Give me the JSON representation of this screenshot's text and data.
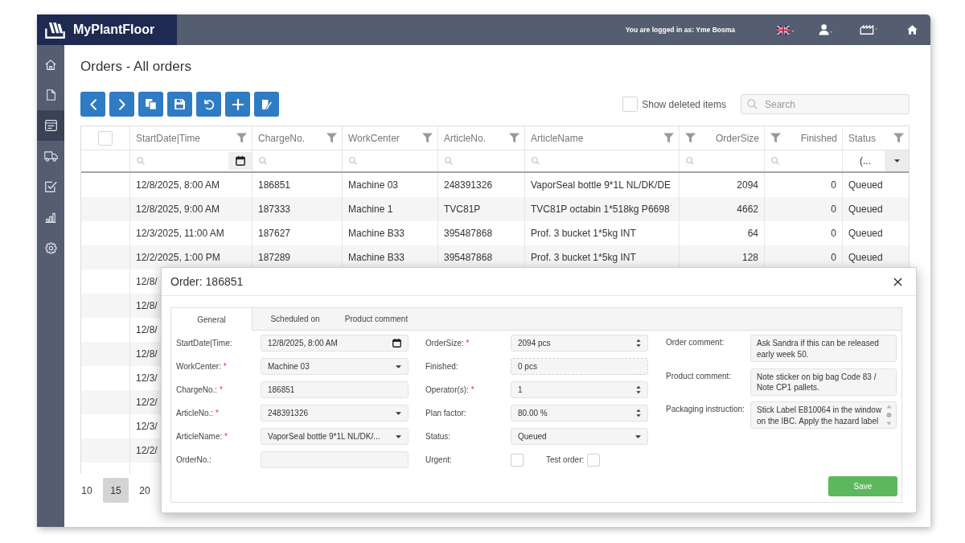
{
  "header": {
    "app_name": "MyPlantFloor",
    "login_text": "You are logged in as: Yme Bosma"
  },
  "sidebar": {
    "items": [
      {
        "kind": "home",
        "selected": false
      },
      {
        "kind": "document",
        "selected": false
      },
      {
        "kind": "orders",
        "selected": true
      },
      {
        "kind": "truck",
        "selected": false
      },
      {
        "kind": "tasks",
        "selected": false
      },
      {
        "kind": "reports",
        "selected": false
      },
      {
        "kind": "settings",
        "selected": false
      }
    ]
  },
  "page": {
    "title": "Orders - All orders"
  },
  "show_deleted": {
    "label": "Show deleted items",
    "checked": false
  },
  "search": {
    "placeholder": "Search"
  },
  "table": {
    "select_all": {
      "checked": false
    },
    "columns": [
      {
        "label": "StartDate|Time",
        "kind": "date"
      },
      {
        "label": "ChargeNo.",
        "kind": "text"
      },
      {
        "label": "WorkCenter",
        "kind": "text"
      },
      {
        "label": "ArticleNo.",
        "kind": "text"
      },
      {
        "label": "ArticleName",
        "kind": "text"
      },
      {
        "label": "OrderSize",
        "kind": "number"
      },
      {
        "label": "Finished",
        "kind": "number"
      },
      {
        "label": "Status",
        "kind": "lookup",
        "filter_value": "(..."
      }
    ],
    "rows": [
      {
        "cells": [
          "12/8/2025, 8:00 AM",
          "186851",
          "Machine 03",
          "248391326",
          "VaporSeal bottle 9*1L NL/DK/DE",
          "2094",
          "0",
          "Queued"
        ]
      },
      {
        "cells": [
          "12/8/2025, 9:00 AM",
          "187333",
          "Machine 1",
          "TVC81P",
          "TVC81P octabin 1*518kg P6698",
          "4662",
          "0",
          "Queued"
        ]
      },
      {
        "cells": [
          "12/3/2025, 11:00 AM",
          "187627",
          "Machine B33",
          "395487868",
          "Prof. 3 bucket 1*5kg INT",
          "64",
          "0",
          "Queued"
        ]
      },
      {
        "cells": [
          "12/2/2025, 1:00 PM",
          "187289",
          "Machine B33",
          "395487868",
          "Prof. 3 bucket 1*5kg INT",
          "128",
          "0",
          "Queued"
        ]
      },
      {
        "cells": [
          "12/8/"
        ]
      },
      {
        "cells": [
          "12/8/"
        ]
      },
      {
        "cells": [
          "12/8/"
        ]
      },
      {
        "cells": [
          "12/8/"
        ]
      },
      {
        "cells": [
          "12/3/"
        ]
      },
      {
        "cells": [
          "12/2/"
        ]
      },
      {
        "cells": [
          "12/3/"
        ]
      },
      {
        "cells": [
          "12/2/"
        ]
      }
    ]
  },
  "pager": {
    "page_sizes": [
      {
        "label": "10",
        "selected": false
      },
      {
        "label": "15",
        "selected": true
      },
      {
        "label": "20",
        "selected": false
      }
    ]
  },
  "dialog": {
    "title": "Order: 186851",
    "tabs": [
      {
        "label": "General",
        "selected": true
      },
      {
        "label": "Scheduled on",
        "selected": false
      },
      {
        "label": "Product comment",
        "selected": false
      }
    ],
    "form": {
      "left": [
        {
          "kind": "date",
          "label": "StartDate|Time:",
          "value": "12/8/2025, 8:00 AM"
        },
        {
          "kind": "select",
          "label": "WorkCenter:",
          "mark": "*",
          "value": "Machine 03"
        },
        {
          "kind": "text",
          "label": "ChargeNo.:",
          "mark": "*",
          "value": "186851"
        },
        {
          "kind": "select",
          "label": "ArticleNo.:",
          "mark": "*",
          "value": "248391326"
        },
        {
          "kind": "select",
          "label": "ArticleName:",
          "mark": "*",
          "value": "VaporSeal bottle 9*1L NL/DK/..."
        },
        {
          "kind": "text",
          "label": "OrderNo.:"
        }
      ],
      "middle": [
        {
          "kind": "number",
          "label": "OrderSize:",
          "mark": "*",
          "value": "2094 pcs"
        },
        {
          "kind": "readonly",
          "label": "Finished:",
          "value": "0 pcs"
        },
        {
          "kind": "number",
          "label": "Operator(s):",
          "mark": "*",
          "value": "1"
        },
        {
          "kind": "number",
          "label": "Plan factor:",
          "value": "80.00 %"
        },
        {
          "kind": "select",
          "label": "Status:",
          "value": "Queued"
        },
        {
          "kind": "checkboxes",
          "items": [
            {
              "label": "Urgent:",
              "checked": false
            },
            {
              "label": "Test order:",
              "checked": false
            }
          ]
        }
      ],
      "right": [
        {
          "kind": "textarea",
          "label": "Order comment:",
          "value": "Ask Sandra if this can be released early week 50."
        },
        {
          "kind": "textarea",
          "label": "Product comment:",
          "value": "Note sticker on big bag Code 83 / Note CP1 pallets."
        },
        {
          "kind": "scroll_textarea",
          "label": "Packaging instruction:",
          "value": "Stick Label E810064 in the window on the IBC. Apply the hazard label"
        }
      ]
    },
    "save_button": "Save"
  }
}
